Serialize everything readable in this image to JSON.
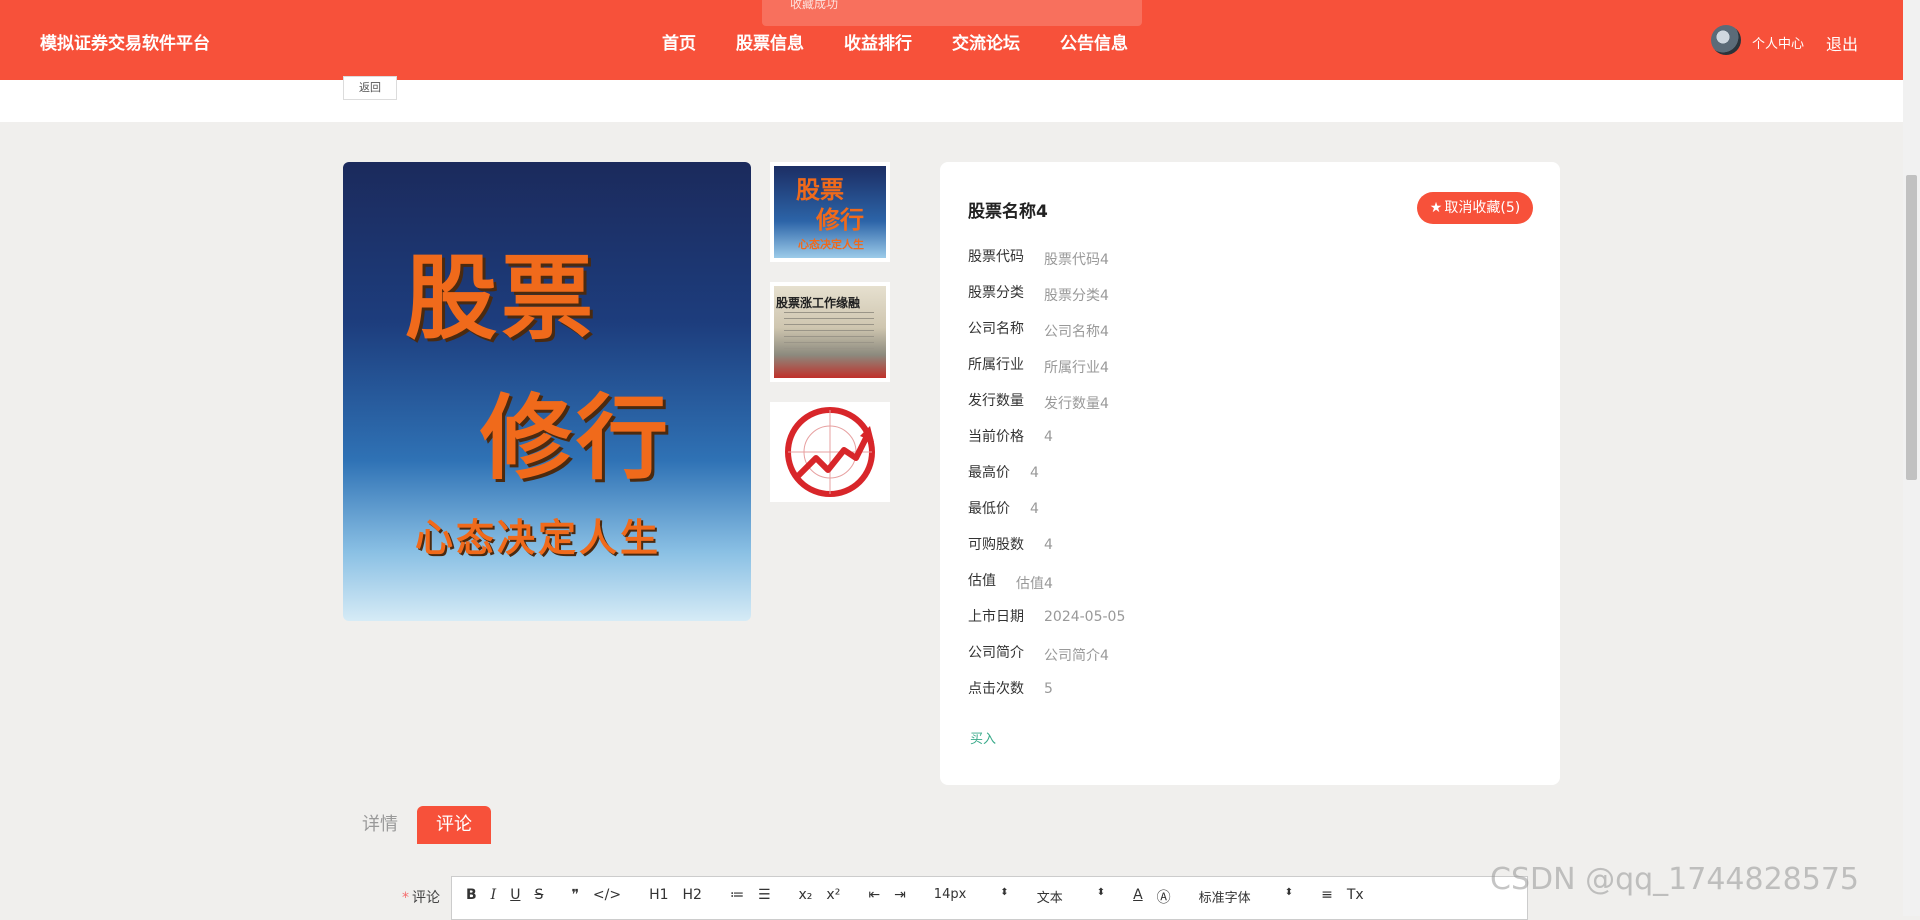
{
  "nav": {
    "brand": "模拟证券交易软件平台",
    "links": [
      "首页",
      "股票信息",
      "收益排行",
      "交流论坛",
      "公告信息"
    ],
    "toast": "收藏成功",
    "user_center": "个人中心",
    "logout": "退出"
  },
  "back_label": "返回",
  "gallery": {
    "main_lines": [
      "股票",
      "修行",
      "心态决定人生"
    ],
    "thumb1_lines": [
      "股票",
      "修行",
      "心态决定人生"
    ],
    "thumb2_title": "股票涨工作缘融"
  },
  "detail": {
    "title": "股票名称4",
    "favorite_label": "取消收藏(5)",
    "fields": [
      {
        "key": "股票代码",
        "value": "股票代码4"
      },
      {
        "key": "股票分类",
        "value": "股票分类4"
      },
      {
        "key": "公司名称",
        "value": "公司名称4"
      },
      {
        "key": "所属行业",
        "value": "所属行业4"
      },
      {
        "key": "发行数量",
        "value": "发行数量4"
      },
      {
        "key": "当前价格",
        "value": "4"
      },
      {
        "key": "最高价",
        "value": "4"
      },
      {
        "key": "最低价",
        "value": "4"
      },
      {
        "key": "可购股数",
        "value": "4"
      },
      {
        "key": "估值",
        "value": "估值4"
      },
      {
        "key": "上市日期",
        "value": "2024-05-05"
      },
      {
        "key": "公司简介",
        "value": "公司简介4"
      },
      {
        "key": "点击次数",
        "value": "5"
      }
    ],
    "buy_label": "买入"
  },
  "tabs": {
    "details": "详情",
    "comments": "评论"
  },
  "comment": {
    "label": "评论",
    "required_mark": "*",
    "toolbar": {
      "bold": "B",
      "italic": "I",
      "underline": "U",
      "strike": "S",
      "quote": "❞",
      "code": "</>",
      "h1": "H1",
      "h2": "H2",
      "ordered": "≔",
      "bullet": "☰",
      "sub": "x₂",
      "sup": "x²",
      "outdent": "⇤",
      "indent": "⇥",
      "size": "14px",
      "format": "文本",
      "color": "A",
      "bg": "Ⓐ",
      "font": "标准字体",
      "align": "≡",
      "clear": "Tx"
    }
  },
  "watermark": "CSDN @qq_1744828575"
}
